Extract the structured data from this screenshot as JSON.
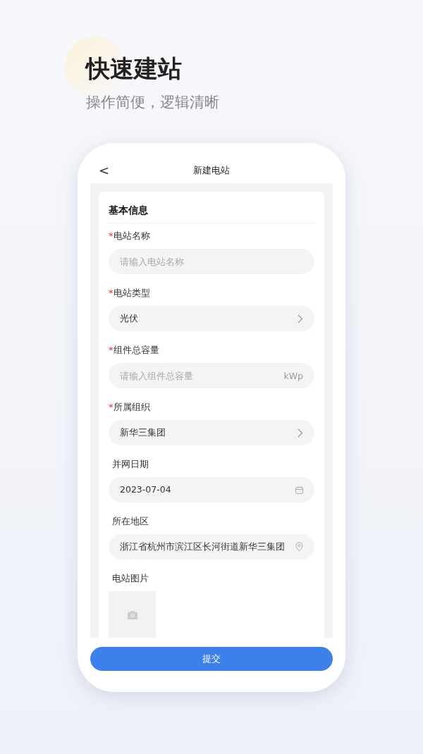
{
  "hero": {
    "title": "快速建站",
    "subtitle": "操作简便，逻辑清晰"
  },
  "header": {
    "back": "<",
    "title": "新建电站"
  },
  "section_title": "基本信息",
  "fields": [
    {
      "kind": "input",
      "required_mark": "*",
      "label": "电站名称",
      "placeholder": "请输入电站名称"
    },
    {
      "kind": "select",
      "required_mark": "*",
      "label": "电站类型",
      "value": "光伏"
    },
    {
      "kind": "input",
      "required_mark": "*",
      "label": "组件总容量",
      "placeholder": "请输入组件总容量",
      "unit": "kWp"
    },
    {
      "kind": "select",
      "required_mark": "*",
      "label": "所属组织",
      "value": "新华三集团"
    },
    {
      "kind": "date",
      "label": "并网日期",
      "value": "2023-07-04"
    },
    {
      "kind": "location",
      "label": "所在地区",
      "value": "浙江省杭州市滨江区长河街道新华三集团"
    },
    {
      "kind": "photo",
      "label": "电站图片"
    }
  ],
  "submit": "提交"
}
